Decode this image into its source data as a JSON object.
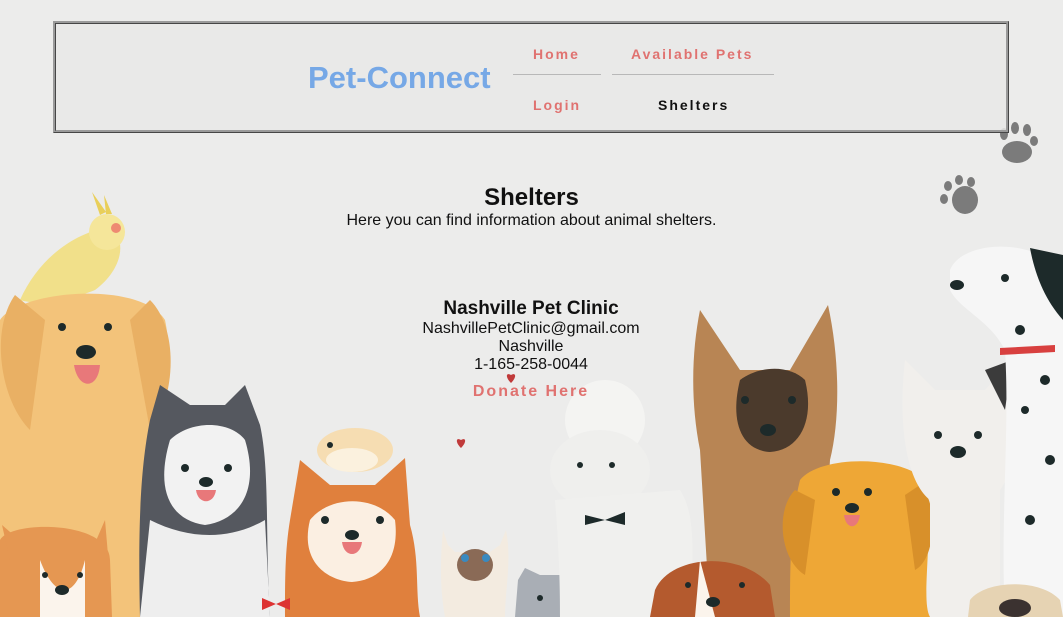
{
  "brand": {
    "name": "Pet-Connect"
  },
  "nav": {
    "home": "Home",
    "available_pets": "Available Pets",
    "login": "Login",
    "shelters": "Shelters"
  },
  "page": {
    "title": "Shelters",
    "subtitle": "Here you can find information about animal shelters."
  },
  "shelter": {
    "name": "Nashville Pet Clinic",
    "email": "NashvillePetClinic@gmail.com",
    "city": "Nashville",
    "phone": "1-165-258-0044",
    "donate_label": "Donate Here"
  },
  "colors": {
    "brand": "#76a8e6",
    "link": "#e07270",
    "active_link": "#111111",
    "background": "#ececeb"
  },
  "background_art": {
    "description_icons": [
      "paw-print-icon",
      "heart-icon",
      "dog-illustration",
      "cat-illustration",
      "cockatiel-illustration",
      "hamster-illustration"
    ]
  }
}
